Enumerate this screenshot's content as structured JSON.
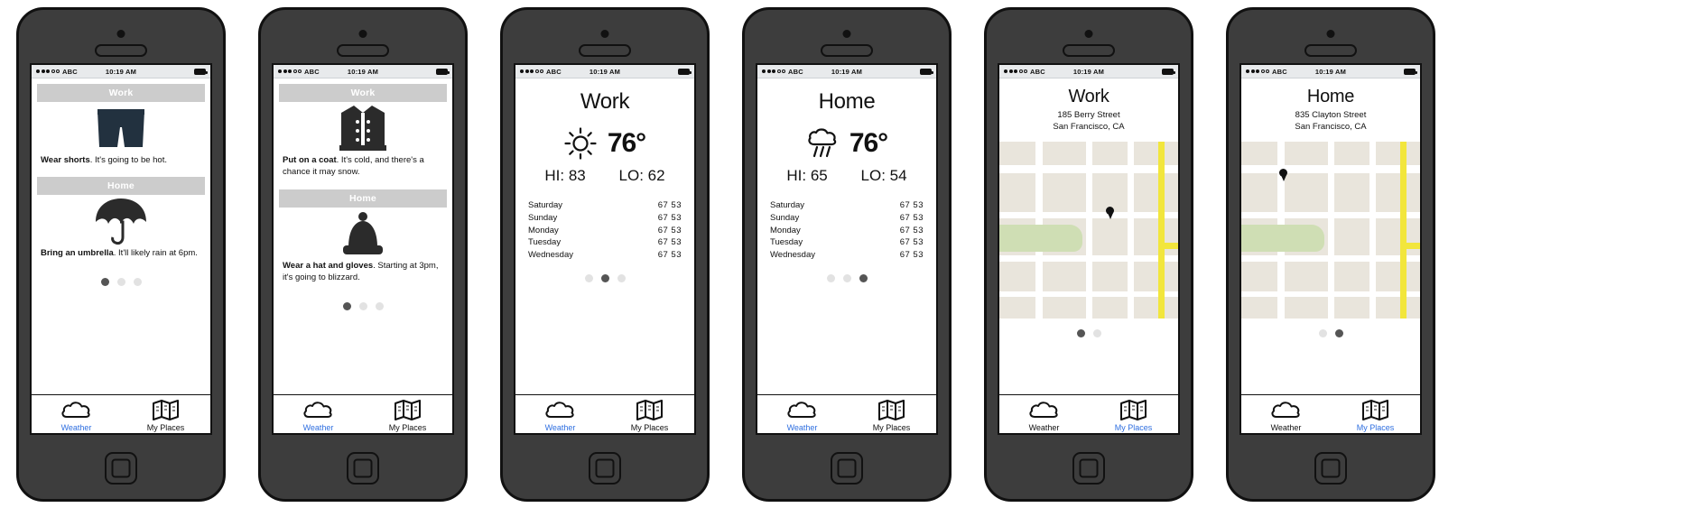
{
  "meta": {
    "app": "Weather wireframe mockup",
    "screens_count": 6
  },
  "statusbar": {
    "carrier": "ABC",
    "time": "10:19 AM",
    "signal_dots_filled": 3,
    "signal_dots_total": 5,
    "battery_icon": "battery-icon"
  },
  "tabbar": {
    "weather_label": "Weather",
    "places_label": "My Places",
    "weather_icon": "cloud-icon",
    "places_icon": "map-icon",
    "active_color": "#2f6fe0"
  },
  "colors": {
    "section_header_bg": "#cccccc",
    "section_header_text": "#ffffff",
    "active_link": "#2f6fe0",
    "pager_active": "#555555",
    "pager_inactive": "#e2e2e2",
    "map_bg": "#e9e5dc",
    "map_road": "#ffffff",
    "map_highway": "#f2e63c",
    "map_park": "#cfdeb4",
    "phone_body": "#3d3d3d"
  },
  "screens": [
    {
      "id": "advice-warm",
      "type": "advice",
      "sections": [
        {
          "header": "Work",
          "icon": "shorts-icon",
          "bold": "Wear shorts",
          "rest": ". It's going to be hot."
        },
        {
          "header": "Home",
          "icon": "umbrella-icon",
          "bold": "Bring an umbrella",
          "rest": ". It'll likely rain at 6pm."
        }
      ],
      "pager": {
        "count": 3,
        "active": 0
      },
      "tab_active": "weather"
    },
    {
      "id": "advice-cold",
      "type": "advice",
      "sections": [
        {
          "header": "Work",
          "icon": "coat-icon",
          "bold": "Put on a coat",
          "rest": ". It's cold, and there's a chance it may snow."
        },
        {
          "header": "Home",
          "icon": "hat-icon",
          "bold": "Wear a hat and gloves",
          "rest": ". Starting at 3pm, it's going to blizzard."
        }
      ],
      "pager": {
        "count": 3,
        "active": 0
      },
      "tab_active": "weather"
    },
    {
      "id": "weather-work",
      "type": "weather",
      "title": "Work",
      "condition_icon": "sun-icon",
      "temperature": "76°",
      "hi_label": "HI: 83",
      "lo_label": "LO: 62",
      "forecast": [
        {
          "day": "Saturday",
          "temps": "67 53"
        },
        {
          "day": "Sunday",
          "temps": "67 53"
        },
        {
          "day": "Monday",
          "temps": "67 53"
        },
        {
          "day": "Tuesday",
          "temps": "67 53"
        },
        {
          "day": "Wednesday",
          "temps": "67 53"
        }
      ],
      "pager": {
        "count": 3,
        "active": 1
      },
      "tab_active": "weather"
    },
    {
      "id": "weather-home",
      "type": "weather",
      "title": "Home",
      "condition_icon": "rain-cloud-icon",
      "temperature": "76°",
      "hi_label": "HI: 65",
      "lo_label": "LO: 54",
      "forecast": [
        {
          "day": "Saturday",
          "temps": "67 53"
        },
        {
          "day": "Sunday",
          "temps": "67 53"
        },
        {
          "day": "Monday",
          "temps": "67 53"
        },
        {
          "day": "Tuesday",
          "temps": "67 53"
        },
        {
          "day": "Wednesday",
          "temps": "67 53"
        }
      ],
      "pager": {
        "count": 3,
        "active": 2
      },
      "tab_active": "weather"
    },
    {
      "id": "places-work",
      "type": "map",
      "title": "Work",
      "address_line1": "185 Berry Street",
      "address_line2": "San Francisco, CA",
      "pin": "map-pin-icon",
      "pager": {
        "count": 2,
        "active": 0
      },
      "tab_active": "places"
    },
    {
      "id": "places-home",
      "type": "map",
      "title": "Home",
      "address_line1": "835 Clayton Street",
      "address_line2": "San Francisco, CA",
      "pin": "map-pin-icon",
      "pager": {
        "count": 2,
        "active": 1
      },
      "tab_active": "places"
    }
  ]
}
